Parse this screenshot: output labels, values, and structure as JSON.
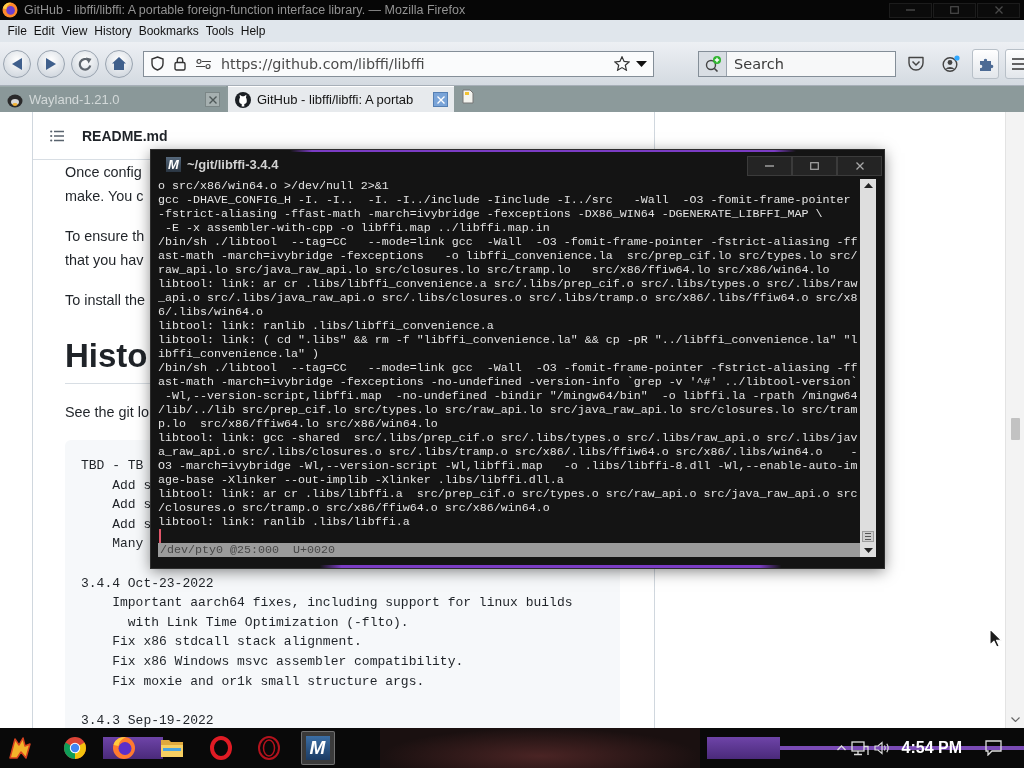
{
  "window": {
    "title": "GitHub - libffi/libffi: A portable foreign-function interface library. — Mozilla Firefox"
  },
  "menu": [
    "File",
    "Edit",
    "View",
    "History",
    "Bookmarks",
    "Tools",
    "Help"
  ],
  "toolbar": {
    "url": "https://github.com/libffi/libffi",
    "search": {
      "placeholder": "Search"
    }
  },
  "tabs": [
    {
      "label": "Wayland-1.21.0",
      "selected": false
    },
    {
      "label": "GitHub - libffi/libffi: A portab",
      "selected": true
    }
  ],
  "readme": {
    "file_name": "README.md",
    "paragraphs": [
      [
        "Once config",
        "make. You c"
      ],
      [
        "To ensure th",
        "that you hav"
      ],
      [
        "To install the"
      ]
    ],
    "heading": "Histo",
    "intro": "See the git lo",
    "changelog": [
      {
        "version": "TBD - TB",
        "changes": [
          "Add s",
          "Add s",
          "Add s",
          "Many"
        ]
      },
      {
        "version": "3.4.4 Oct-23-2022",
        "changes": [
          "Important aarch64 fixes, including support for linux builds\n  with Link Time Optimization (-flto).",
          "Fix x86 stdcall stack alignment.",
          "Fix x86 Windows msvc assembler compatibility.",
          "Fix moxie and or1k small structure args."
        ]
      },
      {
        "version": "3.4.3 Sep-19-2022"
      }
    ]
  },
  "terminal": {
    "logo": "M",
    "title": "~/git/libffi-3.4.4",
    "lines": [
      "o src/x86/win64.o >/dev/null 2>&1",
      "gcc -DHAVE_CONFIG_H -I. -I..  -I. -I../include -Iinclude -I../src   -Wall  -O3 -fomit-frame-pointer",
      "-fstrict-aliasing -ffast-math -march=ivybridge -fexceptions -DX86_WIN64 -DGENERATE_LIBFFI_MAP \\",
      " -E -x assembler-with-cpp -o libffi.map ../libffi.map.in",
      "/bin/sh ./libtool  --tag=CC   --mode=link gcc  -Wall  -O3 -fomit-frame-pointer -fstrict-aliasing -ff",
      "ast-math -march=ivybridge -fexceptions   -o libffi_convenience.la  src/prep_cif.lo src/types.lo src/",
      "raw_api.lo src/java_raw_api.lo src/closures.lo src/tramp.lo   src/x86/ffiw64.lo src/x86/win64.lo",
      "libtool: link: ar cr .libs/libffi_convenience.a src/.libs/prep_cif.o src/.libs/types.o src/.libs/raw",
      "_api.o src/.libs/java_raw_api.o src/.libs/closures.o src/.libs/tramp.o src/x86/.libs/ffiw64.o src/x8",
      "6/.libs/win64.o",
      "libtool: link: ranlib .libs/libffi_convenience.a",
      "libtool: link: ( cd \".libs\" && rm -f \"libffi_convenience.la\" && cp -pR \"../libffi_convenience.la\" \"l",
      "ibffi_convenience.la\" )",
      "/bin/sh ./libtool  --tag=CC   --mode=link gcc  -Wall  -O3 -fomit-frame-pointer -fstrict-aliasing -ff",
      "ast-math -march=ivybridge -fexceptions -no-undefined -version-info `grep -v '^#' ../libtool-version`",
      " -Wl,--version-script,libffi.map  -no-undefined -bindir \"/mingw64/bin\"  -o libffi.la -rpath /mingw64",
      "/lib/../lib src/prep_cif.lo src/types.lo src/raw_api.lo src/java_raw_api.lo src/closures.lo src/tram",
      "p.lo  src/x86/ffiw64.lo src/x86/win64.lo",
      "libtool: link: gcc -shared  src/.libs/prep_cif.o src/.libs/types.o src/.libs/raw_api.o src/.libs/jav",
      "a_raw_api.o src/.libs/closures.o src/.libs/tramp.o src/x86/.libs/ffiw64.o src/x86/.libs/win64.o    -",
      "O3 -march=ivybridge -Wl,--version-script -Wl,libffi.map   -o .libs/libffi-8.dll -Wl,--enable-auto-im",
      "age-base -Xlinker --out-implib -Xlinker .libs/libffi.dll.a",
      "libtool: link: ar cr .libs/libffi.a  src/prep_cif.o src/types.o src/raw_api.o src/java_raw_api.o src",
      "/closures.o src/tramp.o src/x86/ffiw64.o src/x86/win64.o",
      "libtool: link: ranlib .libs/libffi.a"
    ],
    "status": "/dev/pty0 @25:000  U+0020"
  },
  "taskbar": {
    "apps": [
      {
        "kind": "emblem",
        "selected": false
      },
      {
        "kind": "aperture",
        "selected": false
      },
      {
        "kind": "fox",
        "selected": false
      },
      {
        "kind": "folder",
        "selected": false
      },
      {
        "kind": "ring",
        "selected": false
      },
      {
        "kind": "doublering",
        "selected": false
      },
      {
        "kind": "monogram",
        "letter": "M",
        "selected": true
      }
    ],
    "clock": "4:54 PM"
  }
}
